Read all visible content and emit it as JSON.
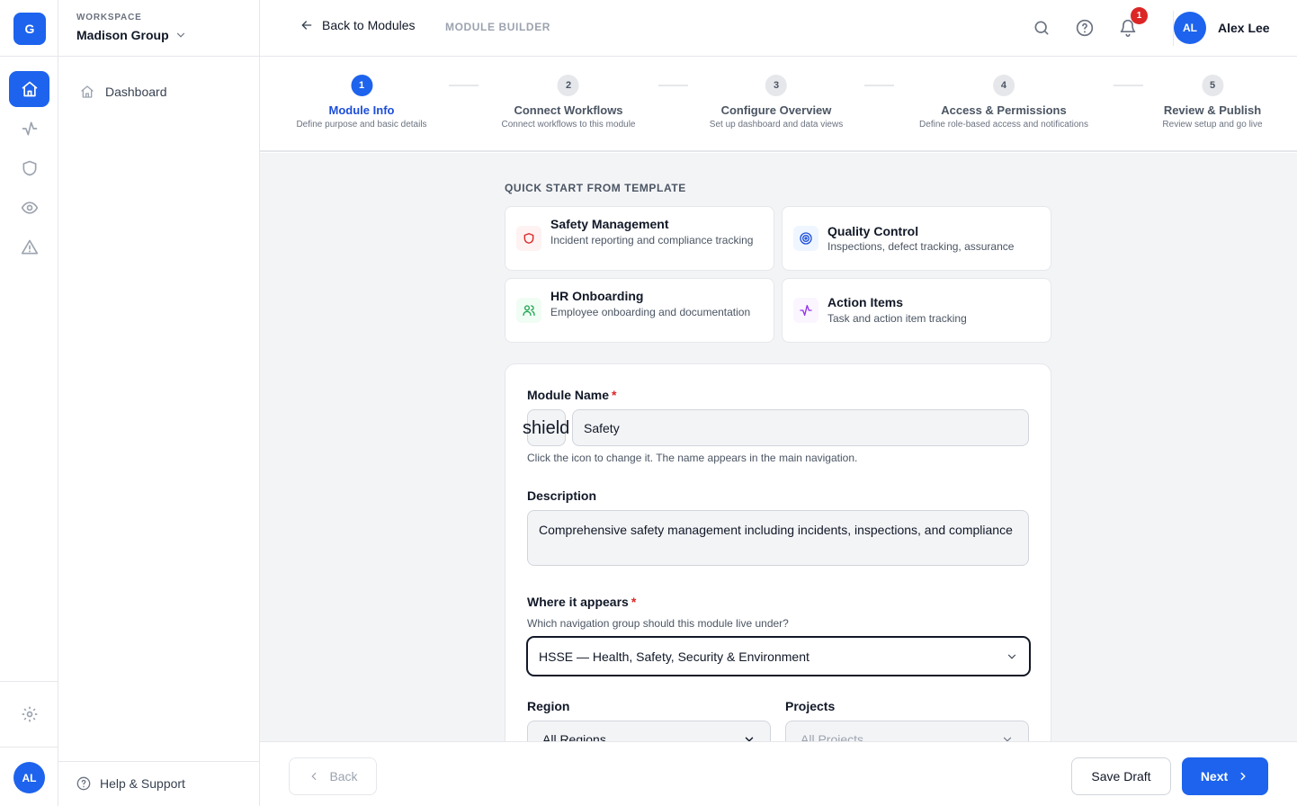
{
  "workspace": {
    "initial": "G",
    "label": "WORKSPACE",
    "name": "Madison Group"
  },
  "rail": {
    "icons": [
      "home-icon",
      "activity-icon",
      "shield-icon",
      "eye-icon",
      "alert-triangle-icon",
      "gear-icon"
    ],
    "user_initials": "AL"
  },
  "sidebar": {
    "items": [
      {
        "label": "Dashboard",
        "icon": "home-icon"
      }
    ],
    "help_label": "Help & Support"
  },
  "header": {
    "back_label": "Back to Modules",
    "section_label": "MODULE BUILDER",
    "notification_count": "1",
    "user_initials": "AL",
    "user_name": "Alex Lee"
  },
  "steps": [
    {
      "num": "1",
      "title": "Module Info",
      "sub": "Define purpose and basic details",
      "active": true
    },
    {
      "num": "2",
      "title": "Connect Workflows",
      "sub": "Connect workflows to this module"
    },
    {
      "num": "3",
      "title": "Configure Overview",
      "sub": "Set up dashboard and data views"
    },
    {
      "num": "4",
      "title": "Access & Permissions",
      "sub": "Define role-based access and notifications"
    },
    {
      "num": "5",
      "title": "Review & Publish",
      "sub": "Review setup and go live"
    }
  ],
  "quick_start": {
    "title": "QUICK START FROM TEMPLATE",
    "templates": [
      {
        "title": "Safety Management",
        "desc": "Incident reporting and compliance tracking",
        "icon": "shield-icon",
        "color": "#dc2626"
      },
      {
        "title": "Quality Control",
        "desc": "Inspections, defect tracking, assurance",
        "icon": "target-icon",
        "color": "#1d4ed8"
      },
      {
        "title": "HR Onboarding",
        "desc": "Employee onboarding and documentation",
        "icon": "users-icon",
        "color": "#16a34a"
      },
      {
        "title": "Action Items",
        "desc": "Task and action item tracking",
        "icon": "activity-icon",
        "color": "#9333ea"
      }
    ]
  },
  "form": {
    "name_label": "Module Name",
    "required_mark": "*",
    "icon_value": "shield",
    "name_value": "Safety",
    "name_hint": "Click the icon to change it. The name appears in the main navigation.",
    "description_label": "Description",
    "description_value": "Comprehensive safety management including incidents, inspections, and compliance",
    "where_label": "Where it appears",
    "where_hint": "Which navigation group should this module live under?",
    "where_value": "HSSE — Health, Safety, Security & Environment",
    "region_label": "Region",
    "region_value": "All Regions",
    "projects_label": "Projects",
    "projects_value": "All Projects"
  },
  "footer": {
    "back_label": "Back",
    "save_label": "Save Draft",
    "next_label": "Next"
  },
  "colors": {
    "accent": "#1d63ed",
    "danger": "#dc2626"
  }
}
